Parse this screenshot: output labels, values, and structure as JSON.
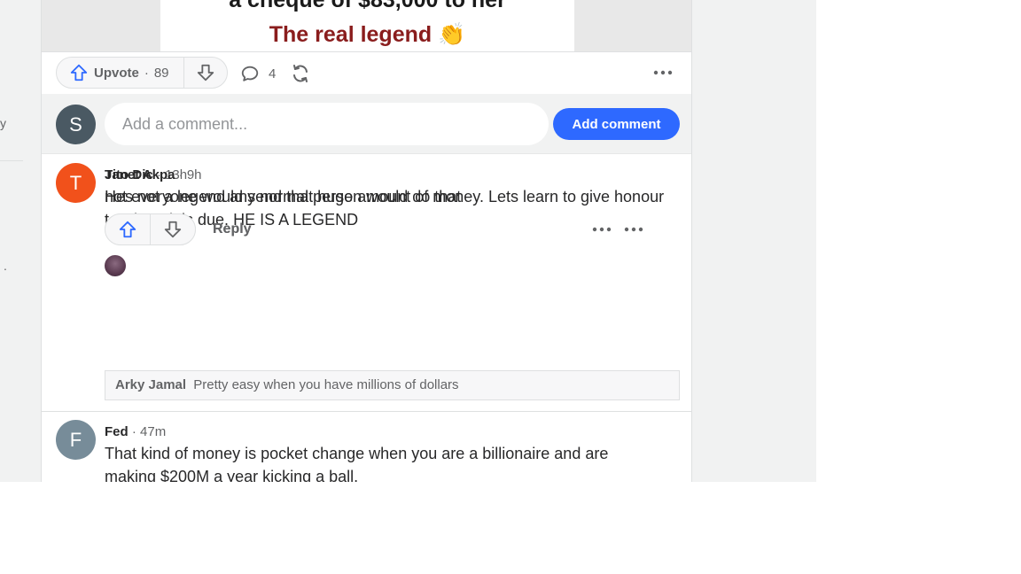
{
  "left_sidebar": {
    "frag_1": "y",
    "frag_2": "."
  },
  "post": {
    "image_text_line1": "a cheque of $83,000 to her",
    "image_text_line2": "The real legend 👏",
    "upvote_label": "Upvote",
    "upvote_count": "89",
    "comment_count": "4"
  },
  "composer": {
    "avatar_letter": "S",
    "placeholder": "Add a comment...",
    "submit_label": "Add comment"
  },
  "comments": [
    {
      "avatar_letter": "T",
      "author": "Tito Dic",
      "time": "· 13h",
      "text": "Hes not a legend any normal person would do that",
      "reply_label": "Reply",
      "replies": [
        {
          "author": "Janet Akpa",
          "time": "· 9h",
          "text": "not everyone would send that huge amount of money. Lets learn to give honour to whom it is due. HE IS A LEGEND",
          "reply_label": "Reply"
        }
      ],
      "collapsed_reply": {
        "author": "Arky Jamal",
        "text": "Pretty easy when you have millions of dollars"
      }
    },
    {
      "avatar_letter": "F",
      "author": "Fed",
      "time": "· 47m",
      "text": "That kind of money is pocket change when you are a billionaire and are making $200M a year kicking a ball."
    }
  ],
  "colors": {
    "accent_blue": "#2e69ff",
    "avatar_t": "#f1511b",
    "avatar_s": "#4a5963",
    "avatar_f": "#778c99"
  }
}
